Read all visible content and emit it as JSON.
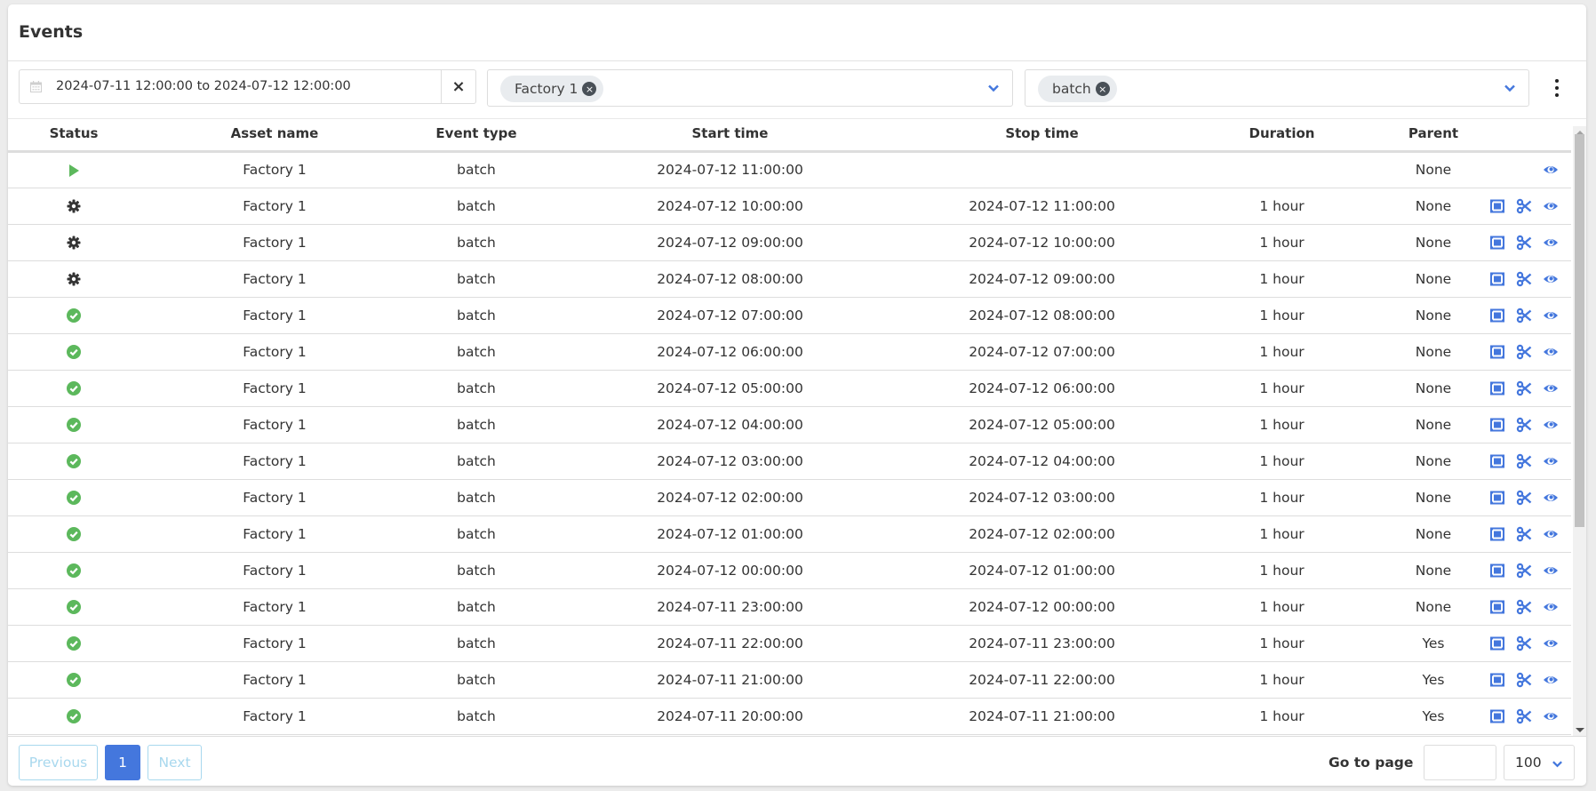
{
  "page": {
    "title": "Events"
  },
  "filters": {
    "date_range": "2024-07-11 12:00:00 to 2024-07-12 12:00:00",
    "date_clear_label": "×",
    "asset_chip": "Factory 1",
    "event_type_chip": "batch",
    "chip_remove_label": "×"
  },
  "colors": {
    "accent": "#4477dd",
    "success": "#5cb85c",
    "running": "#5cb85c",
    "processing": "#333333",
    "pager_disabled": "#a8d8ee"
  },
  "table": {
    "columns": [
      "Status",
      "Asset name",
      "Event type",
      "Start time",
      "Stop time",
      "Duration",
      "Parent"
    ],
    "rows": [
      {
        "status": "running",
        "asset": "Factory 1",
        "type": "batch",
        "start": "2024-07-12 11:00:00",
        "stop": "",
        "duration": "",
        "parent": "None",
        "actions": [
          "view"
        ]
      },
      {
        "status": "processing",
        "asset": "Factory 1",
        "type": "batch",
        "start": "2024-07-12 10:00:00",
        "stop": "2024-07-12 11:00:00",
        "duration": "1 hour",
        "parent": "None",
        "actions": [
          "split-window",
          "cut",
          "view"
        ]
      },
      {
        "status": "processing",
        "asset": "Factory 1",
        "type": "batch",
        "start": "2024-07-12 09:00:00",
        "stop": "2024-07-12 10:00:00",
        "duration": "1 hour",
        "parent": "None",
        "actions": [
          "split-window",
          "cut",
          "view"
        ]
      },
      {
        "status": "processing",
        "asset": "Factory 1",
        "type": "batch",
        "start": "2024-07-12 08:00:00",
        "stop": "2024-07-12 09:00:00",
        "duration": "1 hour",
        "parent": "None",
        "actions": [
          "split-window",
          "cut",
          "view"
        ]
      },
      {
        "status": "done",
        "asset": "Factory 1",
        "type": "batch",
        "start": "2024-07-12 07:00:00",
        "stop": "2024-07-12 08:00:00",
        "duration": "1 hour",
        "parent": "None",
        "actions": [
          "split-window",
          "cut",
          "view"
        ]
      },
      {
        "status": "done",
        "asset": "Factory 1",
        "type": "batch",
        "start": "2024-07-12 06:00:00",
        "stop": "2024-07-12 07:00:00",
        "duration": "1 hour",
        "parent": "None",
        "actions": [
          "split-window",
          "cut",
          "view"
        ]
      },
      {
        "status": "done",
        "asset": "Factory 1",
        "type": "batch",
        "start": "2024-07-12 05:00:00",
        "stop": "2024-07-12 06:00:00",
        "duration": "1 hour",
        "parent": "None",
        "actions": [
          "split-window",
          "cut",
          "view"
        ]
      },
      {
        "status": "done",
        "asset": "Factory 1",
        "type": "batch",
        "start": "2024-07-12 04:00:00",
        "stop": "2024-07-12 05:00:00",
        "duration": "1 hour",
        "parent": "None",
        "actions": [
          "split-window",
          "cut",
          "view"
        ]
      },
      {
        "status": "done",
        "asset": "Factory 1",
        "type": "batch",
        "start": "2024-07-12 03:00:00",
        "stop": "2024-07-12 04:00:00",
        "duration": "1 hour",
        "parent": "None",
        "actions": [
          "split-window",
          "cut",
          "view"
        ]
      },
      {
        "status": "done",
        "asset": "Factory 1",
        "type": "batch",
        "start": "2024-07-12 02:00:00",
        "stop": "2024-07-12 03:00:00",
        "duration": "1 hour",
        "parent": "None",
        "actions": [
          "split-window",
          "cut",
          "view"
        ]
      },
      {
        "status": "done",
        "asset": "Factory 1",
        "type": "batch",
        "start": "2024-07-12 01:00:00",
        "stop": "2024-07-12 02:00:00",
        "duration": "1 hour",
        "parent": "None",
        "actions": [
          "split-window",
          "cut",
          "view"
        ]
      },
      {
        "status": "done",
        "asset": "Factory 1",
        "type": "batch",
        "start": "2024-07-12 00:00:00",
        "stop": "2024-07-12 01:00:00",
        "duration": "1 hour",
        "parent": "None",
        "actions": [
          "split-window",
          "cut",
          "view"
        ]
      },
      {
        "status": "done",
        "asset": "Factory 1",
        "type": "batch",
        "start": "2024-07-11 23:00:00",
        "stop": "2024-07-12 00:00:00",
        "duration": "1 hour",
        "parent": "None",
        "actions": [
          "split-window",
          "cut",
          "view"
        ]
      },
      {
        "status": "done",
        "asset": "Factory 1",
        "type": "batch",
        "start": "2024-07-11 22:00:00",
        "stop": "2024-07-11 23:00:00",
        "duration": "1 hour",
        "parent": "Yes",
        "actions": [
          "split-window",
          "cut",
          "view"
        ]
      },
      {
        "status": "done",
        "asset": "Factory 1",
        "type": "batch",
        "start": "2024-07-11 21:00:00",
        "stop": "2024-07-11 22:00:00",
        "duration": "1 hour",
        "parent": "Yes",
        "actions": [
          "split-window",
          "cut",
          "view"
        ]
      },
      {
        "status": "done",
        "asset": "Factory 1",
        "type": "batch",
        "start": "2024-07-11 20:00:00",
        "stop": "2024-07-11 21:00:00",
        "duration": "1 hour",
        "parent": "Yes",
        "actions": [
          "split-window",
          "cut",
          "view"
        ]
      }
    ]
  },
  "pagination": {
    "previous_label": "Previous",
    "current_page": "1",
    "next_label": "Next",
    "goto_label": "Go to page",
    "goto_value": "",
    "page_size": "100"
  }
}
